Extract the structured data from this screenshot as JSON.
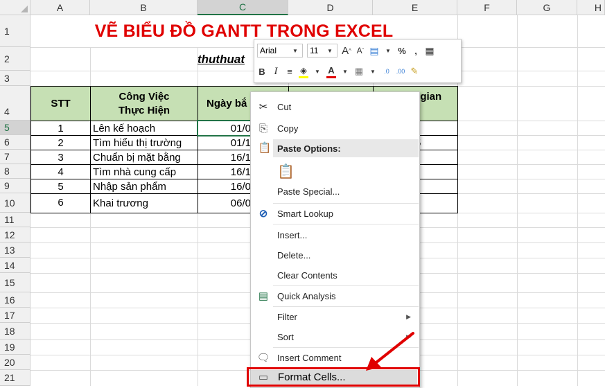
{
  "columns": [
    "A",
    "B",
    "C",
    "D",
    "E",
    "F",
    "G",
    "H"
  ],
  "rows": [
    "1",
    "2",
    "3",
    "4",
    "5",
    "6",
    "7",
    "8",
    "9",
    "10",
    "11",
    "12",
    "13",
    "14",
    "15",
    "16",
    "17",
    "18",
    "19",
    "20",
    "21"
  ],
  "sheet": {
    "title": "VẼ BIỂU ĐỒ GANTT TRONG EXCEL",
    "subtitle": "thuthuat",
    "headers": {
      "stt": "STT",
      "task": "Công Việc\nThực Hiện",
      "start": "Ngày bắ",
      "duration": "Thời gian\nhành"
    },
    "table": [
      {
        "stt": "1",
        "task": "Lên kế hoạch",
        "start": "01/0",
        "dur": ")"
      },
      {
        "stt": "2",
        "task": "Tìm hiểu thị trường",
        "start": "01/1",
        "dur": "5"
      },
      {
        "stt": "3",
        "task": "Chuẩn bị mặt bằng",
        "start": "16/1",
        "dur": ")"
      },
      {
        "stt": "4",
        "task": "Tìm nhà cung cấp",
        "start": "16/1",
        "dur": ""
      },
      {
        "stt": "5",
        "task": "Nhập sản phẩm",
        "start": "16/0",
        "dur": ""
      },
      {
        "stt": "6",
        "task": "Khai trương",
        "start": "06/0",
        "dur": ""
      }
    ]
  },
  "mini_toolbar": {
    "font": "Arial",
    "size": "11",
    "grow_font": "A",
    "shrink_font": "A",
    "percent": "%",
    "comma": ",",
    "bold": "B",
    "italic": "I",
    "font_color_letter": "A",
    "inc_decimal": ".00",
    "dec_decimal": ".0"
  },
  "context_menu": {
    "cut": "Cut",
    "copy": "Copy",
    "paste_options": "Paste Options:",
    "paste_special": "Paste Special...",
    "smart_lookup": "Smart Lookup",
    "insert": "Insert...",
    "delete": "Delete...",
    "clear_contents": "Clear Contents",
    "quick_analysis": "Quick Analysis",
    "filter": "Filter",
    "sort": "Sort",
    "insert_comment": "Insert Comment",
    "format_cells": "Format Cells..."
  },
  "colors": {
    "title_red": "#e00000",
    "header_green": "#c6e0b4",
    "excel_green": "#217346",
    "highlight_red": "#e00000"
  }
}
